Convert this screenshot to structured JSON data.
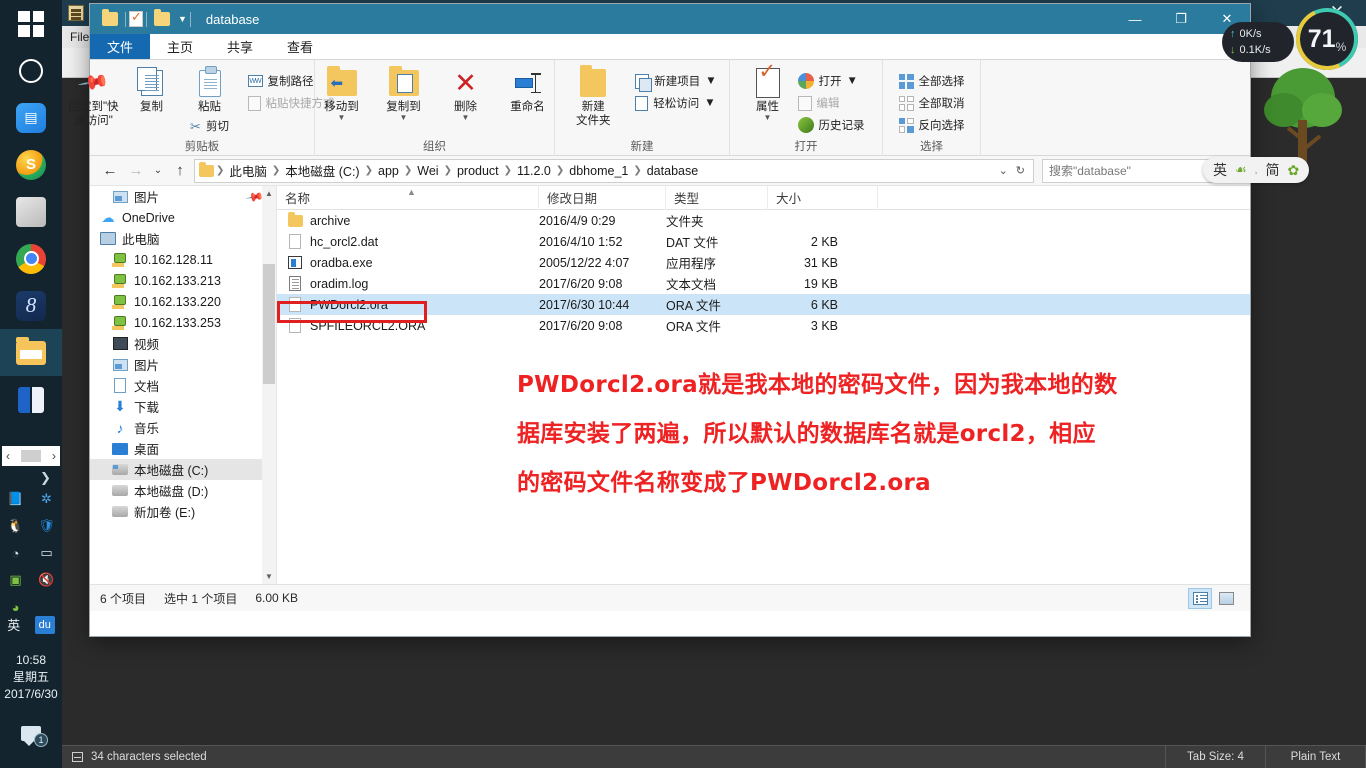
{
  "taskbar": {
    "items": [
      {
        "name": "start-button",
        "icon": "windows-logo-icon"
      },
      {
        "name": "cortana-search",
        "icon": "circle-icon"
      },
      {
        "name": "task-view",
        "icon": "task-view-icon"
      },
      {
        "name": "sogou-browser",
        "icon": "sogou-icon"
      },
      {
        "name": "screenshot-tool",
        "icon": "screenshot-icon"
      },
      {
        "name": "google-chrome",
        "icon": "chrome-icon"
      },
      {
        "name": "app-eight",
        "icon": "eight-icon"
      },
      {
        "name": "file-explorer",
        "icon": "folder-icon"
      },
      {
        "name": "reader-app",
        "icon": "book-icon"
      }
    ],
    "tray": {
      "lang": "英",
      "baidu": "du"
    },
    "clock": {
      "time": "10:58",
      "weekday": "星期五",
      "date": "2017/6/30"
    },
    "notification_count": "1"
  },
  "npp": {
    "title": "",
    "menus": [
      "File"
    ],
    "status": {
      "selection": "34 characters selected",
      "tab_size": "Tab Size: 4",
      "language": "Plain Text"
    }
  },
  "explorer": {
    "title": "database",
    "window_buttons": {
      "minimize": "—",
      "maximize": "❐",
      "close": "✕"
    },
    "tabs": [
      {
        "label": "文件",
        "name": "tab-file"
      },
      {
        "label": "主页",
        "name": "tab-home"
      },
      {
        "label": "共享",
        "name": "tab-share"
      },
      {
        "label": "查看",
        "name": "tab-view"
      }
    ],
    "ribbon": {
      "groups": [
        {
          "label": "剪贴板",
          "name": "ribbon-group-clipboard",
          "big": [
            {
              "label": "固定到\"快\n速访问\"",
              "name": "pin-to-quick-access",
              "icon": "pin-icon"
            },
            {
              "label": "复制",
              "name": "copy-button",
              "icon": "copy-icon"
            },
            {
              "label": "粘贴",
              "name": "paste-button",
              "icon": "clipboard-icon"
            }
          ],
          "small": [
            {
              "label": "剪切",
              "name": "cut-button",
              "icon": "scissors-icon",
              "dim": false
            },
            {
              "label": "复制路径",
              "name": "copy-path-button",
              "icon": "copy-path-icon",
              "dim": false
            },
            {
              "label": "粘贴快捷方式",
              "name": "paste-shortcut-button",
              "icon": "shortcut-icon",
              "dim": true
            }
          ]
        },
        {
          "label": "组织",
          "name": "ribbon-group-organize",
          "big": [
            {
              "label": "移动到",
              "name": "move-to-button",
              "icon": "move-to-icon"
            },
            {
              "label": "复制到",
              "name": "copy-to-button",
              "icon": "copy-to-icon"
            },
            {
              "label": "删除",
              "name": "delete-button",
              "icon": "delete-icon"
            },
            {
              "label": "重命名",
              "name": "rename-button",
              "icon": "rename-icon"
            }
          ]
        },
        {
          "label": "新建",
          "name": "ribbon-group-new",
          "big": [
            {
              "label": "新建\n文件夹",
              "name": "new-folder-button",
              "icon": "new-folder-icon"
            }
          ],
          "small": [
            {
              "label": "新建项目",
              "name": "new-item-button",
              "icon": "new-item-icon",
              "dim": false
            },
            {
              "label": "轻松访问",
              "name": "easy-access-button",
              "icon": "easy-access-icon",
              "dim": false
            }
          ]
        },
        {
          "label": "打开",
          "name": "ribbon-group-open",
          "big": [
            {
              "label": "属性",
              "name": "properties-button",
              "icon": "properties-icon"
            }
          ],
          "small": [
            {
              "label": "打开",
              "name": "open-button",
              "icon": "open-icon",
              "dim": false
            },
            {
              "label": "编辑",
              "name": "edit-button",
              "icon": "edit-icon",
              "dim": true
            },
            {
              "label": "历史记录",
              "name": "history-button",
              "icon": "history-icon",
              "dim": false
            }
          ]
        },
        {
          "label": "选择",
          "name": "ribbon-group-select",
          "small": [
            {
              "label": "全部选择",
              "name": "select-all-button",
              "icon": "select-all-icon",
              "dim": false
            },
            {
              "label": "全部取消",
              "name": "select-none-button",
              "icon": "select-none-icon",
              "dim": false
            },
            {
              "label": "反向选择",
              "name": "invert-selection-button",
              "icon": "invert-selection-icon",
              "dim": false
            }
          ]
        }
      ]
    },
    "address": {
      "breadcrumbs": [
        "此电脑",
        "本地磁盘 (C:)",
        "app",
        "Wei",
        "product",
        "11.2.0",
        "dbhome_1",
        "database"
      ],
      "search_placeholder": "搜索\"database\"",
      "back": "←",
      "forward": "→",
      "recent": "⌄",
      "up": "↑",
      "refresh": "↻",
      "dropdown": "⌄"
    },
    "nav_tree": [
      {
        "label": "图片",
        "icon": "picture-icon",
        "indent": 1,
        "pinned": true,
        "selected": false
      },
      {
        "label": "OneDrive",
        "icon": "onedrive-icon",
        "indent": 0,
        "pinned": false,
        "selected": false
      },
      {
        "label": "此电脑",
        "icon": "this-pc-icon",
        "indent": 0,
        "pinned": false,
        "selected": false
      },
      {
        "label": "10.162.128.11",
        "icon": "network-drive-icon",
        "indent": 1,
        "pinned": false,
        "selected": false
      },
      {
        "label": "10.162.133.213",
        "icon": "network-drive-icon",
        "indent": 1,
        "pinned": false,
        "selected": false
      },
      {
        "label": "10.162.133.220",
        "icon": "network-drive-icon",
        "indent": 1,
        "pinned": false,
        "selected": false
      },
      {
        "label": "10.162.133.253",
        "icon": "network-drive-icon",
        "indent": 1,
        "pinned": false,
        "selected": false
      },
      {
        "label": "视频",
        "icon": "video-icon",
        "indent": 1,
        "pinned": false,
        "selected": false
      },
      {
        "label": "图片",
        "icon": "picture-icon",
        "indent": 1,
        "pinned": false,
        "selected": false
      },
      {
        "label": "文档",
        "icon": "document-icon",
        "indent": 1,
        "pinned": false,
        "selected": false
      },
      {
        "label": "下载",
        "icon": "download-icon",
        "indent": 1,
        "pinned": false,
        "selected": false
      },
      {
        "label": "音乐",
        "icon": "music-icon",
        "indent": 1,
        "pinned": false,
        "selected": false
      },
      {
        "label": "桌面",
        "icon": "desktop-icon",
        "indent": 1,
        "pinned": false,
        "selected": false
      },
      {
        "label": "本地磁盘 (C:)",
        "icon": "system-drive-icon",
        "indent": 1,
        "pinned": false,
        "selected": true
      },
      {
        "label": "本地磁盘 (D:)",
        "icon": "drive-icon",
        "indent": 1,
        "pinned": false,
        "selected": false
      },
      {
        "label": "新加卷 (E:)",
        "icon": "drive-icon",
        "indent": 1,
        "pinned": false,
        "selected": false
      }
    ],
    "list": {
      "columns": [
        "名称",
        "修改日期",
        "类型",
        "大小"
      ],
      "rows": [
        {
          "name": "archive",
          "date": "2016/4/9 0:29",
          "type": "文件夹",
          "size": "",
          "icon": "folder-icon",
          "selected": false
        },
        {
          "name": "hc_orcl2.dat",
          "date": "2016/4/10 1:52",
          "type": "DAT 文件",
          "size": "2 KB",
          "icon": "blank-file-icon",
          "selected": false
        },
        {
          "name": "oradba.exe",
          "date": "2005/12/22 4:07",
          "type": "应用程序",
          "size": "31 KB",
          "icon": "exe-file-icon",
          "selected": false
        },
        {
          "name": "oradim.log",
          "date": "2017/6/20 9:08",
          "type": "文本文档",
          "size": "19 KB",
          "icon": "log-file-icon",
          "selected": false
        },
        {
          "name": "PWDorcl2.ora",
          "date": "2017/6/30 10:44",
          "type": "ORA 文件",
          "size": "6 KB",
          "icon": "blank-file-icon",
          "selected": true
        },
        {
          "name": "SPFILEORCL2.ORA",
          "date": "2017/6/20 9:08",
          "type": "ORA 文件",
          "size": "3 KB",
          "icon": "blank-file-icon",
          "selected": false
        }
      ]
    },
    "status": {
      "item_count": "6 个项目",
      "selection": "选中 1 个项目",
      "selection_size": "6.00 KB"
    }
  },
  "annotation": {
    "line1": "PWDorcl2.ora就是我本地的密码文件，因为我本地的数",
    "line2": "据库安装了两遍，所以默认的数据库名就是orcl2，相应",
    "line3": "的密码文件名称变成了PWDorcl2.ora",
    "color": "#ee2222"
  },
  "overlays": {
    "netspeed": {
      "upload": "0K/s",
      "download": "0.1K/s"
    },
    "cpu": {
      "value": "71",
      "unit": "%"
    },
    "ime": {
      "lang": "英",
      "mode": "简",
      "leaf": "☙",
      "gear": "✿"
    }
  }
}
